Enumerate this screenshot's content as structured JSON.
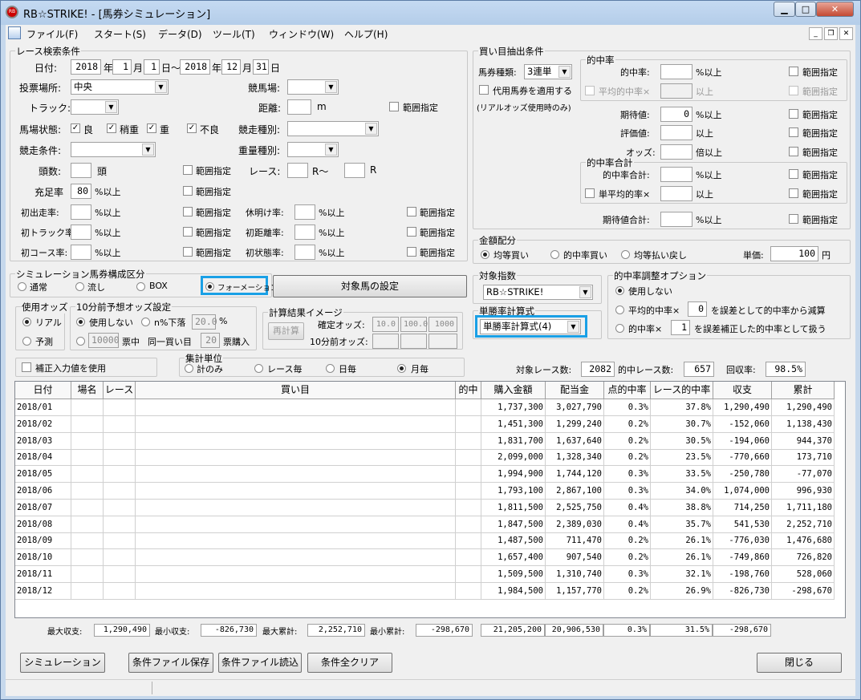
{
  "window": {
    "title": "RB☆STRIKE! - [馬券シミュレーション]",
    "icon": "app-logo-icon"
  },
  "menu": [
    "ファイル(F)",
    "スタート(S)",
    "データ(D)",
    "ツール(T)",
    "ウィンドウ(W)",
    "ヘルプ(H)"
  ],
  "race": {
    "group": "レース検索条件",
    "date_label": "日付:",
    "from_year": "2018",
    "year_unit": "年",
    "from_month": "1",
    "month_unit": "月",
    "from_day": "1",
    "day_to": "日～",
    "to_year": "2018",
    "to_month": "12",
    "to_day": "31",
    "day_unit": "日",
    "venue_type_label": "投票場所:",
    "venue_type": "中央",
    "course_label": "競馬場:",
    "track_label": "トラック:",
    "distance_label": "距離:",
    "m": "m",
    "range": "範囲指定",
    "condition_label": "馬場状態:",
    "cond": [
      "良",
      "稍重",
      "重",
      "不良"
    ],
    "race_kind_label": "競走種別:",
    "race_cond_label": "競走条件:",
    "weight_label": "重量種別:",
    "heads_label": "頭数:",
    "heads_unit": "頭",
    "race_label": "レース:",
    "r_from": "R～",
    "r": "R",
    "fill_label": "充足率",
    "fill_val": "80",
    "pct_over": "%以上",
    "rows3": [
      [
        "初出走率:",
        "休明け率:"
      ],
      [
        "初トラック率:",
        "初距離率:"
      ],
      [
        "初コース率:",
        "初状態率:"
      ]
    ]
  },
  "composition": {
    "group": "シミュレーション馬券構成区分",
    "options": [
      "通常",
      "流し",
      "BOX",
      "フォーメーション"
    ],
    "target_btn": "対象馬の設定"
  },
  "odds": {
    "group": "使用オッズ",
    "options": [
      "リアル",
      "予測"
    ]
  },
  "pre10": {
    "group": "10分前予想オッズ設定",
    "opt1": "使用しない",
    "opt2": "n%下落",
    "n_val": "20.0",
    "pct": "%",
    "amount": "10000",
    "ticket_mid": "票中",
    "same_buy": "同一買い目",
    "same_val": "20",
    "ticket_buy": "票購入"
  },
  "calc": {
    "group": "計算結果イメージ",
    "recalc": "再計算",
    "fixed_label": "確定オッズ:",
    "fixed": [
      "10.0",
      "100.0",
      "1000"
    ],
    "pre_label": "10分前オッズ:"
  },
  "correct": "補正入力値を使用",
  "unit": {
    "group": "集計単位",
    "options": [
      "計のみ",
      "レース毎",
      "日毎",
      "月毎"
    ]
  },
  "extract": {
    "group": "買い目抽出条件",
    "type_label": "馬券種類:",
    "type": "3連単",
    "sub": "代用馬券を適用する",
    "note": "(リアルオッズ使用時のみ)",
    "hit_group": "的中率",
    "hit_label": "的中率:",
    "avg_hit": "平均的中率×",
    "over": "%以上",
    "over2": "以上",
    "range": "範囲指定",
    "exp_label": "期待値:",
    "exp_val": "0",
    "eval_label": "評価値:",
    "odds_label": "オッズ:",
    "odds_unit": "倍以上",
    "hitsum_group": "的中率合計",
    "hitsum_label": "的中率合計:",
    "single_avg": "単平均的率×",
    "expsum_label": "期待値合計:"
  },
  "money": {
    "group": "金額配分",
    "options": [
      "均等買い",
      "的中率買い",
      "均等払い戻し"
    ],
    "unit_label": "単価:",
    "unit_val": "100",
    "yen": "円"
  },
  "target": {
    "group": "対象指数",
    "value": "RB☆STRIKE!"
  },
  "wincalc": {
    "group": "単勝率計算式",
    "value": "単勝率計算式(4)"
  },
  "adjust": {
    "group": "的中率調整オプション",
    "opt1": "使用しない",
    "opt2a": "平均的中率×",
    "opt2v": "0",
    "opt2b": "を誤差として的中率から減算",
    "opt3a": "的中率×",
    "opt3v": "1",
    "opt3b": "を誤差補正した的中率として扱う"
  },
  "summary": {
    "races_label": "対象レース数:",
    "races": "2082",
    "hit_label": "的中レース数:",
    "hit": "657",
    "ret_label": "回収率:",
    "ret": "98.5%"
  },
  "table": {
    "headers": [
      "日付",
      "場名",
      "レース",
      "買い目",
      "的中",
      "購入金額",
      "配当金",
      "点的中率",
      "レース的中率",
      "収支",
      "累計"
    ],
    "rows": [
      [
        "2018/01",
        "",
        "",
        "",
        "",
        "1,737,300",
        "3,027,790",
        "0.3%",
        "37.8%",
        "1,290,490",
        "1,290,490"
      ],
      [
        "2018/02",
        "",
        "",
        "",
        "",
        "1,451,300",
        "1,299,240",
        "0.2%",
        "30.7%",
        "-152,060",
        "1,138,430"
      ],
      [
        "2018/03",
        "",
        "",
        "",
        "",
        "1,831,700",
        "1,637,640",
        "0.2%",
        "30.5%",
        "-194,060",
        "944,370"
      ],
      [
        "2018/04",
        "",
        "",
        "",
        "",
        "2,099,000",
        "1,328,340",
        "0.2%",
        "23.5%",
        "-770,660",
        "173,710"
      ],
      [
        "2018/05",
        "",
        "",
        "",
        "",
        "1,994,900",
        "1,744,120",
        "0.3%",
        "33.5%",
        "-250,780",
        "-77,070"
      ],
      [
        "2018/06",
        "",
        "",
        "",
        "",
        "1,793,100",
        "2,867,100",
        "0.3%",
        "34.0%",
        "1,074,000",
        "996,930"
      ],
      [
        "2018/07",
        "",
        "",
        "",
        "",
        "1,811,500",
        "2,525,750",
        "0.4%",
        "38.8%",
        "714,250",
        "1,711,180"
      ],
      [
        "2018/08",
        "",
        "",
        "",
        "",
        "1,847,500",
        "2,389,030",
        "0.4%",
        "35.7%",
        "541,530",
        "2,252,710"
      ],
      [
        "2018/09",
        "",
        "",
        "",
        "",
        "1,487,500",
        "711,470",
        "0.2%",
        "26.1%",
        "-776,030",
        "1,476,680"
      ],
      [
        "2018/10",
        "",
        "",
        "",
        "",
        "1,657,400",
        "907,540",
        "0.2%",
        "26.1%",
        "-749,860",
        "726,820"
      ],
      [
        "2018/11",
        "",
        "",
        "",
        "",
        "1,509,500",
        "1,310,740",
        "0.3%",
        "32.1%",
        "-198,760",
        "528,060"
      ],
      [
        "2018/12",
        "",
        "",
        "",
        "",
        "1,984,500",
        "1,157,770",
        "0.2%",
        "26.9%",
        "-826,730",
        "-298,670"
      ]
    ]
  },
  "footer": {
    "max_label": "最大収支:",
    "max": "1,290,490",
    "min_label": "最小収支:",
    "min": "-826,730",
    "maxc_label": "最大累計:",
    "maxc": "2,252,710",
    "minc_label": "最小累計:",
    "minc": "-298,670",
    "total_buy": "21,205,200",
    "total_pay": "20,906,530",
    "total_pt": "0.3%",
    "total_race": "31.5%",
    "total_last": "-298,670"
  },
  "buttons": {
    "sim": "シミュレーション",
    "save": "条件ファイル保存",
    "load": "条件ファイル読込",
    "clear": "条件全クリア",
    "close": "閉じる"
  }
}
